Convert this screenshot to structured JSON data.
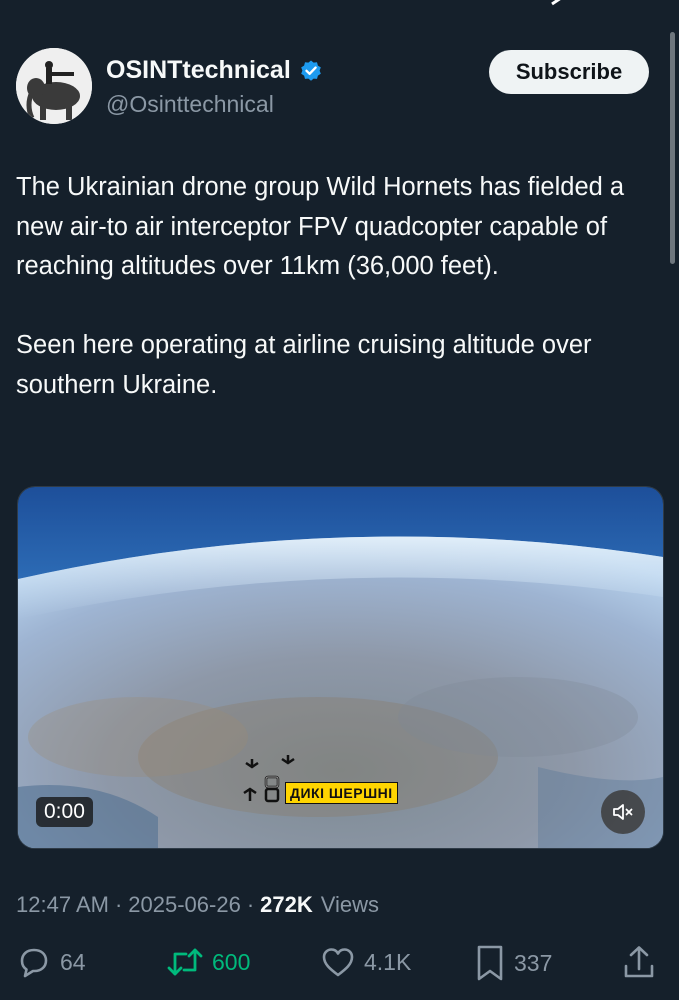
{
  "profile": {
    "display_name": "OSINTtechnical",
    "handle": "@Osinttechnical",
    "verified_icon": "verified-badge-icon",
    "subscribe_label": "Subscribe"
  },
  "tweet": {
    "paragraphs": [
      "The Ukrainian drone group Wild Hornets has fielded a new air-to air interceptor FPV quadcopter capable of reaching altitudes over 11km (36,000 feet).",
      "Seen here operating at airline cruising altitude over southern Ukraine."
    ]
  },
  "media": {
    "time": "0:00",
    "watermark_text": "ДИКІ ШЕРШНІ",
    "mute_icon": "speaker-muted-icon"
  },
  "meta": {
    "time": "12:47 AM",
    "separator": "·",
    "date": "2025-06-26",
    "views_count": "272K",
    "views_label": "Views"
  },
  "actions": {
    "replies": "64",
    "retweets": "600",
    "likes": "4.1K",
    "bookmarks": "337"
  },
  "colors": {
    "background": "#15202b",
    "text": "#f7f9f9",
    "muted": "#8b98a5",
    "retweet_active": "#00ba7c",
    "verified": "#1d9bf0"
  }
}
